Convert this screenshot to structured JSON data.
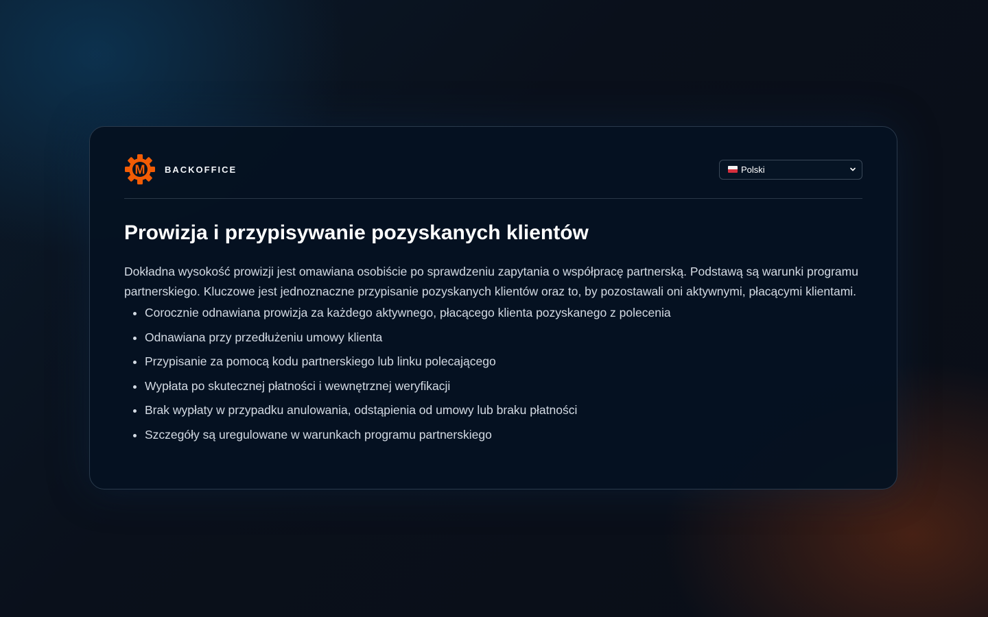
{
  "header": {
    "brand_name": "BACKOFFICE",
    "logo_icon": "gear-m-logo-icon",
    "logo_letter": "M",
    "brand_color": "#f25c05"
  },
  "language_select": {
    "selected_label": "Polski",
    "flag_icon": "poland-flag-icon"
  },
  "content": {
    "title": "Prowizja i przypisywanie pozyskanych klientów",
    "intro": "Dokładna wysokość prowizji jest omawiana osobiście po sprawdzeniu zapytania o współpracę partnerską. Podstawą są warunki programu partnerskiego. Kluczowe jest jednoznaczne przypisanie pozyskanych klientów oraz to, by pozostawali oni aktywnymi, płacącymi klientami.",
    "points": [
      "Corocznie odnawiana prowizja za każdego aktywnego, płacącego klienta pozyskanego z polecenia",
      "Odnawiana przy przedłużeniu umowy klienta",
      "Przypisanie za pomocą kodu partnerskiego lub linku polecającego",
      "Wypłata po skutecznej płatności i wewnętrznej weryfikacji",
      "Brak wypłaty w przypadku anulowania, odstąpienia od umowy lub braku płatności",
      "Szczegóły są uregulowane w warunkach programu partnerskiego"
    ]
  }
}
